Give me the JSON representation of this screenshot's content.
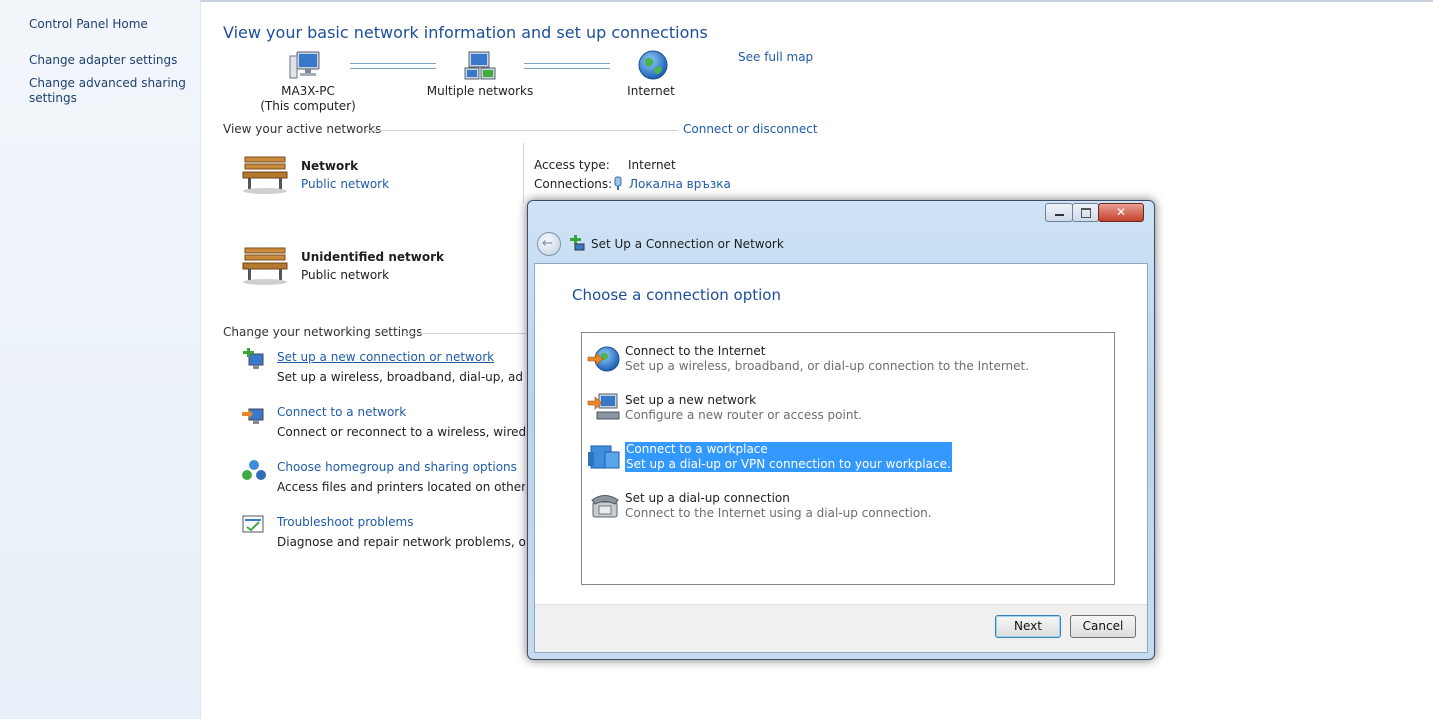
{
  "sidebar": {
    "home": "Control Panel Home",
    "adapter": "Change adapter settings",
    "sharing_line1": "Change advanced sharing",
    "sharing_line2": "settings"
  },
  "main": {
    "title": "View your basic network information and set up connections",
    "see_full_map": "See full map",
    "map": {
      "computer_name": "MA3X-PC",
      "computer_sub": "(This computer)",
      "middle": "Multiple networks",
      "internet": "Internet"
    },
    "active_label": "View your active networks",
    "connect_disconnect": "Connect or disconnect",
    "networks": [
      {
        "name": "Network",
        "type": "Public network"
      },
      {
        "name": "Unidentified network",
        "type": "Public network"
      }
    ],
    "access": {
      "access_label": "Access type:",
      "access_value": "Internet",
      "conn_label": "Connections:",
      "conn_value": "Локална връзка"
    },
    "change_label": "Change your networking settings",
    "tasks": [
      {
        "title": "Set up a new connection or network",
        "desc": "Set up a wireless, broadband, dial-up, ad hoc, o"
      },
      {
        "title": "Connect to a network",
        "desc": "Connect or reconnect to a wireless, wired, dial-"
      },
      {
        "title": "Choose homegroup and sharing options",
        "desc": "Access files and printers located on other netwo"
      },
      {
        "title": "Troubleshoot problems",
        "desc": "Diagnose and repair network problems, or get t"
      }
    ]
  },
  "dialog": {
    "title": "Set Up a Connection or Network",
    "heading": "Choose a connection option",
    "options": [
      {
        "title": "Connect to the Internet",
        "desc": "Set up a wireless, broadband, or dial-up connection to the Internet.",
        "icon": "globe-icon"
      },
      {
        "title": "Set up a new network",
        "desc": "Configure a new router or access point.",
        "icon": "router-icon"
      },
      {
        "title": "Connect to a workplace",
        "desc": "Set up a dial-up or VPN connection to your workplace.",
        "icon": "workplace-icon"
      },
      {
        "title": "Set up a dial-up connection",
        "desc": "Connect to the Internet using a dial-up connection.",
        "icon": "phone-icon"
      }
    ],
    "selected_index": 2,
    "next": "Next",
    "cancel": "Cancel"
  },
  "colors": {
    "link": "#1f5ca8",
    "heading": "#1c4f99",
    "selection": "#3399ff"
  }
}
